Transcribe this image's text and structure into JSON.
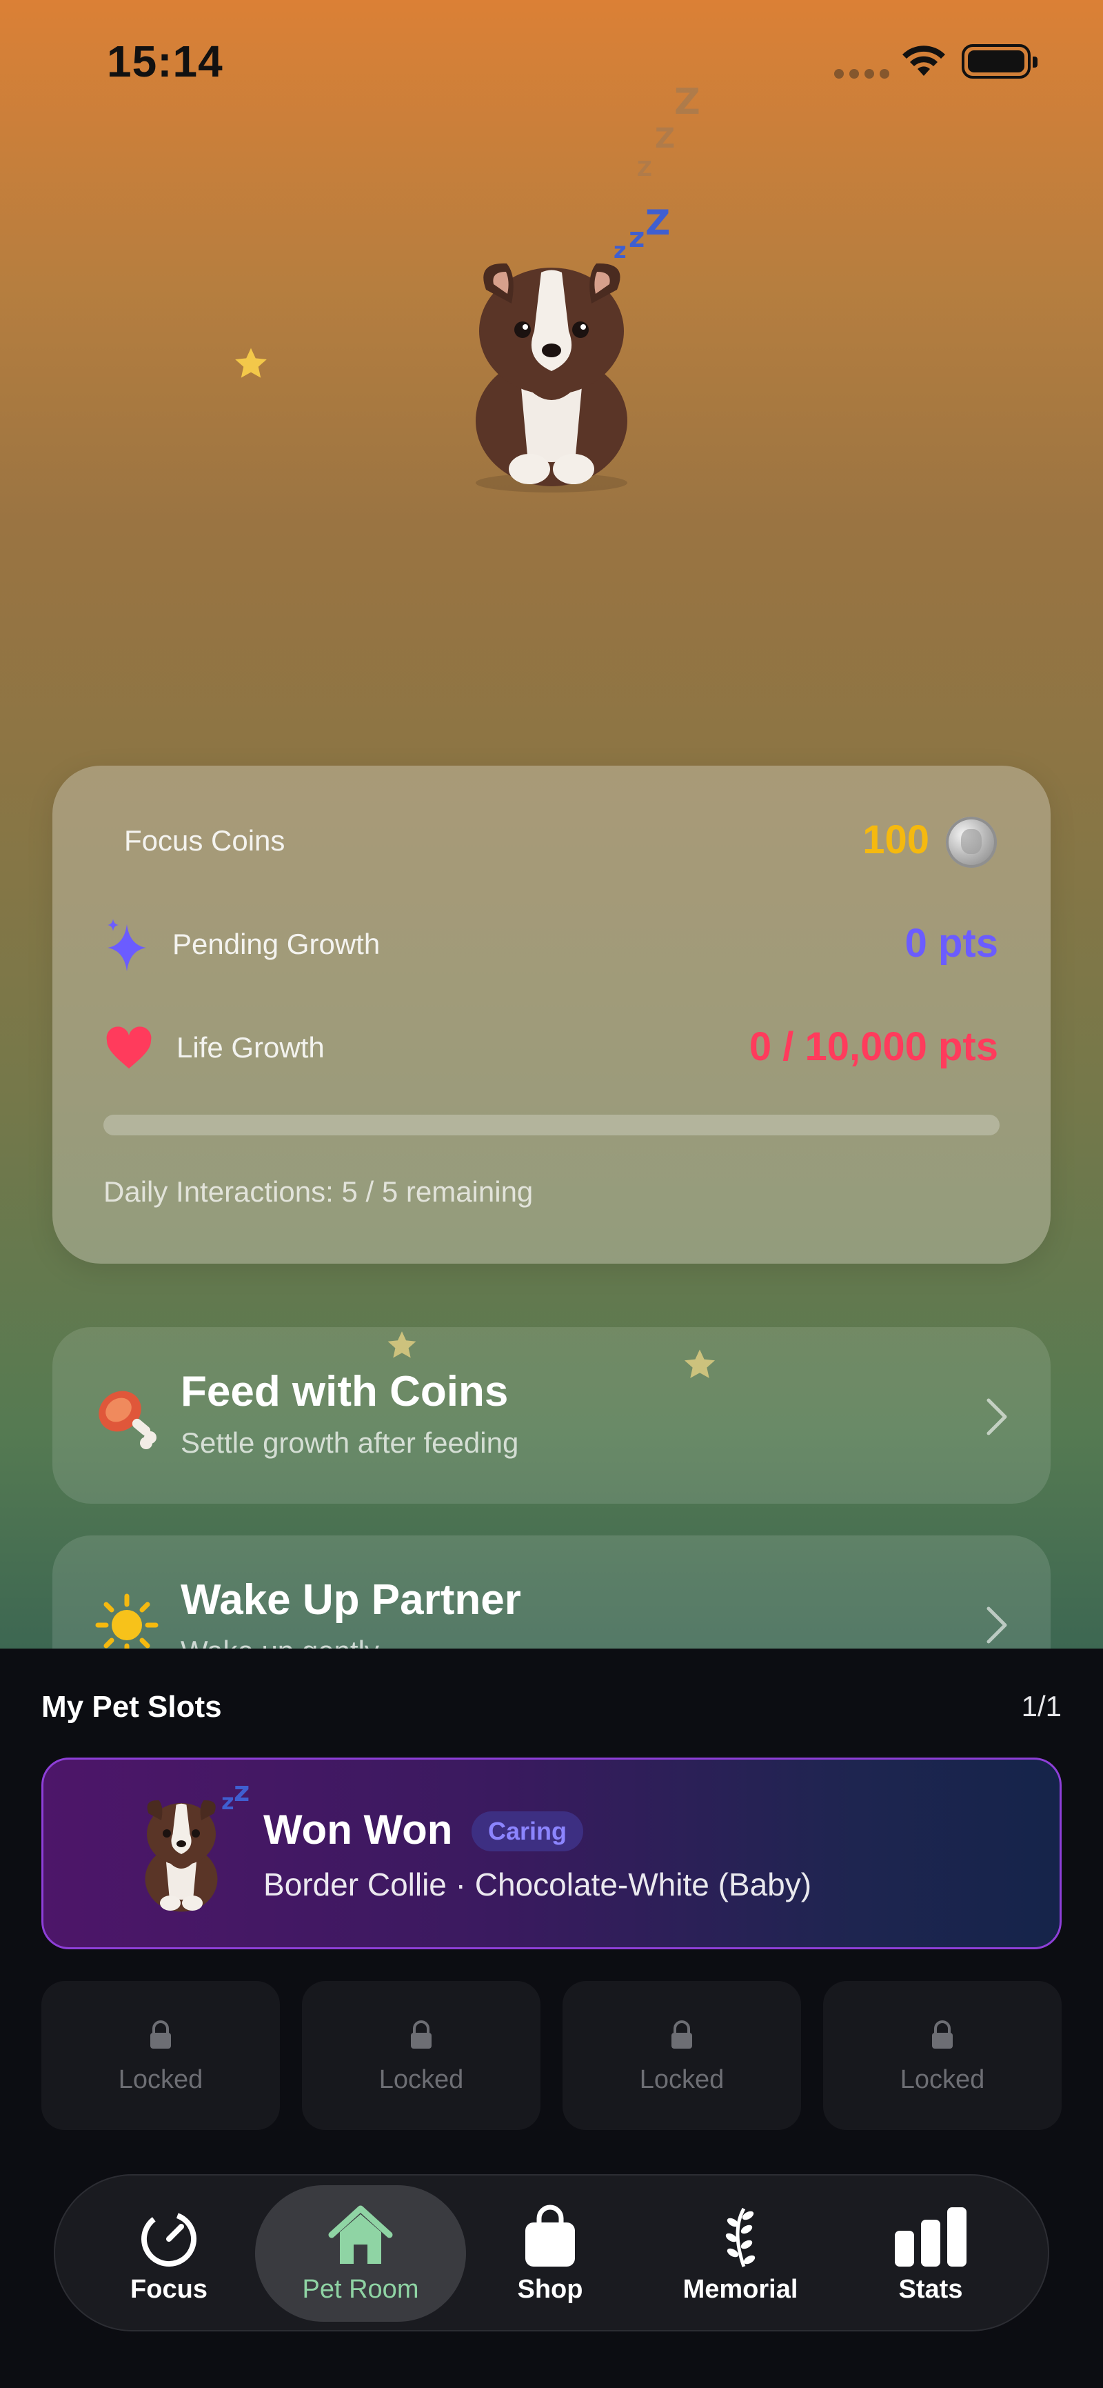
{
  "status_bar": {
    "time": "15:14"
  },
  "stats": {
    "focus_coins_label": "Focus Coins",
    "focus_coins_value": "100",
    "pending_growth_label": "Pending Growth",
    "pending_growth_value": "0 pts",
    "life_growth_label": "Life Growth",
    "life_growth_value": "0 / 10,000 pts",
    "life_growth_progress": 0,
    "daily_interactions": "Daily Interactions: 5 / 5 remaining"
  },
  "actions": [
    {
      "title": "Feed with Coins",
      "subtitle": "Settle growth after feeding",
      "icon": "meat-icon"
    },
    {
      "title": "Wake Up Partner",
      "subtitle": "Wake up gently",
      "icon": "sun-icon"
    }
  ],
  "pet_slots": {
    "title": "My Pet Slots",
    "count": "1/1",
    "pet": {
      "name": "Won Won",
      "badge": "Caring",
      "breed": "Border Collie · Chocolate-White (Baby)"
    },
    "locked": [
      "Locked",
      "Locked",
      "Locked",
      "Locked"
    ]
  },
  "tabs": [
    {
      "label": "Focus",
      "icon": "timer-icon"
    },
    {
      "label": "Pet Room",
      "icon": "house-icon",
      "active": true
    },
    {
      "label": "Shop",
      "icon": "bag-icon"
    },
    {
      "label": "Memorial",
      "icon": "laurel-icon"
    },
    {
      "label": "Stats",
      "icon": "bar-chart-icon"
    }
  ],
  "colors": {
    "coins": "#f5b90f",
    "pending": "#6b5cff",
    "life": "#ff3b5c",
    "active_tab": "#8fd4a4"
  }
}
